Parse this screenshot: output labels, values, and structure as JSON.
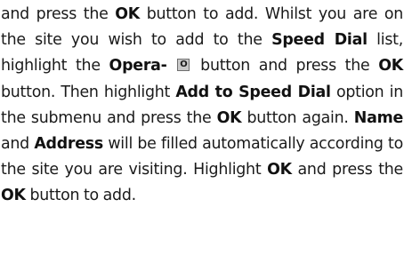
{
  "paragraph": {
    "s1": "and press the ",
    "ok1": "OK",
    "s2": " button to add. Whilst you are on the site you wish to add to the ",
    "speed_dial": "Speed Dial",
    "s3": " list, highlight the ",
    "opera": "Opera-",
    "opera_icon": {
      "icon": "opera-key-icon",
      "glyph": "O"
    },
    "s4": " button and press the ",
    "ok2": "OK",
    "s5": " button. Then highlight ",
    "add_to_speed_dial": "Add to Speed Dial",
    "s6": " option in the submenu and press the ",
    "ok3": "OK",
    "s7": " button again. ",
    "name": "Name",
    "s8": " and ",
    "address": "Address",
    "s9": " will be filled automatically according to the site you are visiting. Highlight ",
    "ok4": "OK",
    "s10": " and press the ",
    "ok5": "OK",
    "s11": " button to add."
  }
}
